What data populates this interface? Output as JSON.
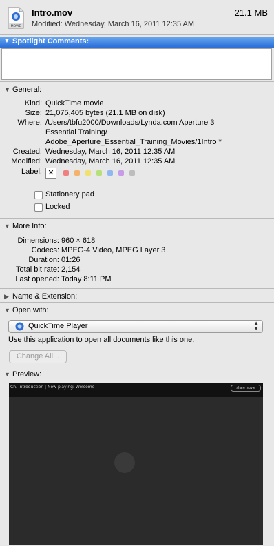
{
  "header": {
    "file_name": "Intro.mov",
    "file_size": "21.1 MB",
    "modified": "Modified: Wednesday, March 16, 2011 12:35 AM",
    "icon_label": "MOVIE"
  },
  "spotlight": {
    "label": "Spotlight Comments:",
    "comment": ""
  },
  "general": {
    "title": "General:",
    "kind_label": "Kind:",
    "kind": "QuickTime movie",
    "size_label": "Size:",
    "size": "21,075,405 bytes (21.1 MB on disk)",
    "where_label": "Where:",
    "where_1": "/Users/tbfu2000/Downloads/Lynda.com Aperture 3",
    "where_2": "Essential Training/",
    "where_3": "Adobe_Aperture_Essential_Training_Movies/1Intro *",
    "created_label": "Created:",
    "created": "Wednesday, March 16, 2011 12:35 AM",
    "modified_label": "Modified:",
    "modified": "Wednesday, March 16, 2011 12:35 AM",
    "label_label": "Label:",
    "label_colors": [
      "#f08080",
      "#f4b26a",
      "#f0e070",
      "#b8e07a",
      "#8fb8f0",
      "#c79be8",
      "#bdbdbd"
    ],
    "stationery": "Stationery pad",
    "locked": "Locked"
  },
  "more_info": {
    "title": "More Info:",
    "dimensions_label": "Dimensions:",
    "dimensions": "960 × 618",
    "codecs_label": "Codecs:",
    "codecs": "MPEG-4 Video, MPEG Layer 3",
    "duration_label": "Duration:",
    "duration": "01:26",
    "bitrate_label": "Total bit rate:",
    "bitrate": "2,154",
    "opened_label": "Last opened:",
    "opened": "Today 8:11 PM"
  },
  "name_ext": {
    "title": "Name & Extension:"
  },
  "open_with": {
    "title": "Open with:",
    "app": "QuickTime Player",
    "hint": "Use this application to open all documents like this one.",
    "change_all": "Change All..."
  },
  "preview": {
    "title": "Preview:",
    "video_title": "Ch. Introduction | Now playing: Welcome",
    "badge": "share movie"
  }
}
